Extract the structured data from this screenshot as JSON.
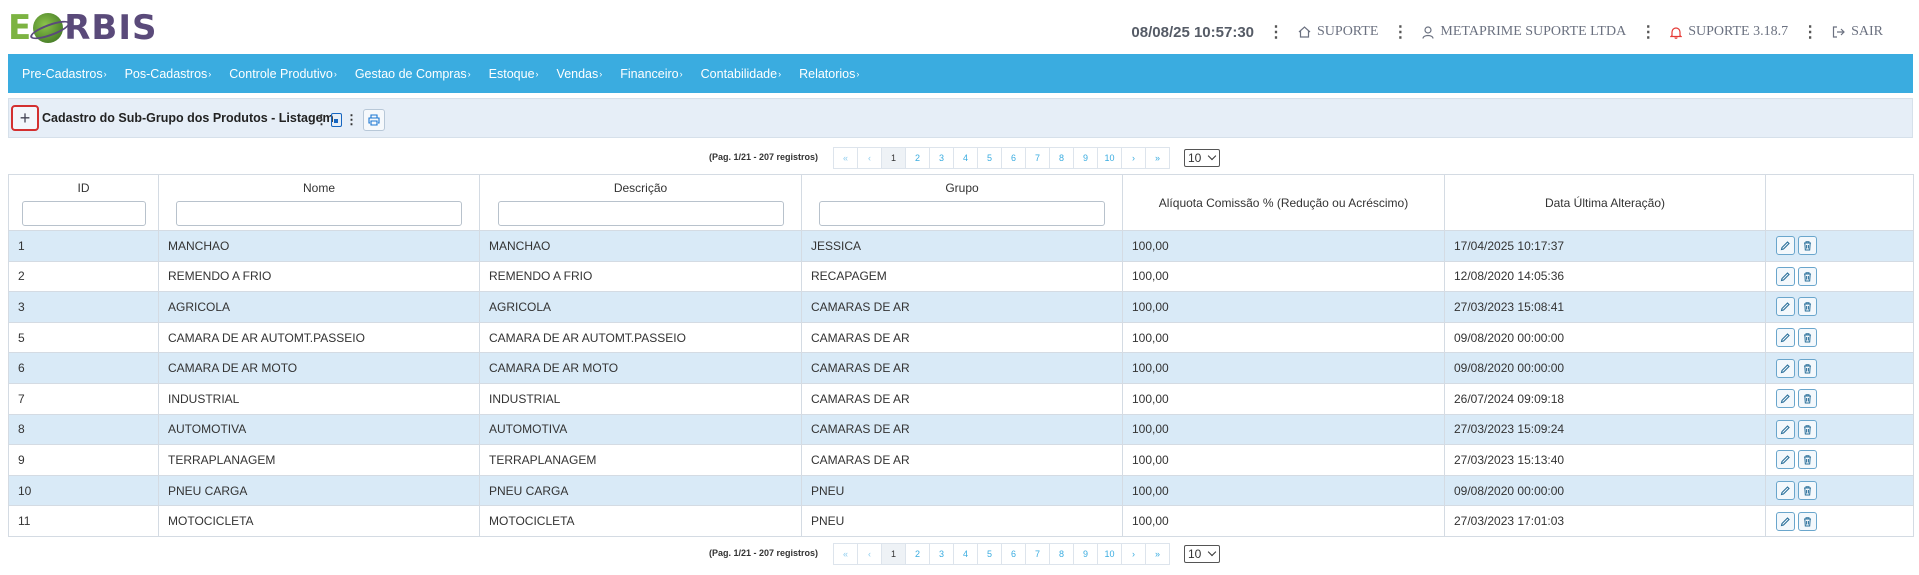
{
  "brand": {
    "logo_first": "E",
    "logo_rest": "RBIS"
  },
  "topbar": {
    "datetime": "08/08/25 10:57:30",
    "home_label": "SUPORTE",
    "user_label": "METAPRIME SUPORTE LTDA",
    "version_label": "SUPORTE 3.18.7",
    "logout_label": "SAIR",
    "sep": "⋮"
  },
  "nav": {
    "items": [
      "Pre-Cadastros",
      "Pos-Cadastros",
      "Controle Produtivo",
      "Gestao de Compras",
      "Estoque",
      "Vendas",
      "Financeiro",
      "Contabilidade",
      "Relatorios"
    ]
  },
  "toolbar": {
    "add_label": "+",
    "title": "Cadastro do Sub-Grupo dos Produtos - Listagem",
    "dots": "⋮"
  },
  "pagination": {
    "info": "(Pag. 1/21 - 207 registros)",
    "first": "«",
    "prev": "‹",
    "pages": [
      "1",
      "2",
      "3",
      "4",
      "5",
      "6",
      "7",
      "8",
      "9",
      "10"
    ],
    "next": "›",
    "last": "»",
    "page_size": "10"
  },
  "table": {
    "columns": [
      "ID",
      "Nome",
      "Descrição",
      "Grupo",
      "Alíquota Comissão % (Redução ou Acréscimo)",
      "Data Última Alteração)",
      ""
    ],
    "rows": [
      [
        "1",
        "MANCHAO",
        "MANCHAO",
        "JESSICA",
        "100,00",
        "17/04/2025 10:17:37"
      ],
      [
        "2",
        "REMENDO A FRIO",
        "REMENDO A FRIO",
        "RECAPAGEM",
        "100,00",
        "12/08/2020 14:05:36"
      ],
      [
        "3",
        "AGRICOLA",
        "AGRICOLA",
        "CAMARAS DE AR",
        "100,00",
        "27/03/2023 15:08:41"
      ],
      [
        "5",
        "CAMARA DE AR AUTOMT.PASSEIO",
        "CAMARA DE AR AUTOMT.PASSEIO",
        "CAMARAS DE AR",
        "100,00",
        "09/08/2020 00:00:00"
      ],
      [
        "6",
        "CAMARA DE AR MOTO",
        "CAMARA DE AR MOTO",
        "CAMARAS DE AR",
        "100,00",
        "09/08/2020 00:00:00"
      ],
      [
        "7",
        "INDUSTRIAL",
        "INDUSTRIAL",
        "CAMARAS DE AR",
        "100,00",
        "26/07/2024 09:09:18"
      ],
      [
        "8",
        "AUTOMOTIVA",
        "AUTOMOTIVA",
        "CAMARAS DE AR",
        "100,00",
        "27/03/2023 15:09:24"
      ],
      [
        "9",
        "TERRAPLANAGEM",
        "TERRAPLANAGEM",
        "CAMARAS DE AR",
        "100,00",
        "27/03/2023 15:13:40"
      ],
      [
        "10",
        "PNEU CARGA",
        "PNEU CARGA",
        "PNEU",
        "100,00",
        "09/08/2020 00:00:00"
      ],
      [
        "11",
        "MOTOCICLETA",
        "MOTOCICLETA",
        "PNEU",
        "100,00",
        "27/03/2023 17:01:03"
      ]
    ]
  },
  "colors": {
    "nav_bg": "#3aace0",
    "row_alt": "#d9eaf7",
    "accent_red": "#d32f2f"
  },
  "icons": [
    "home-icon",
    "user-icon",
    "bell-icon",
    "logout-icon",
    "pdf-icon",
    "print-icon",
    "edit-icon",
    "trash-icon"
  ]
}
